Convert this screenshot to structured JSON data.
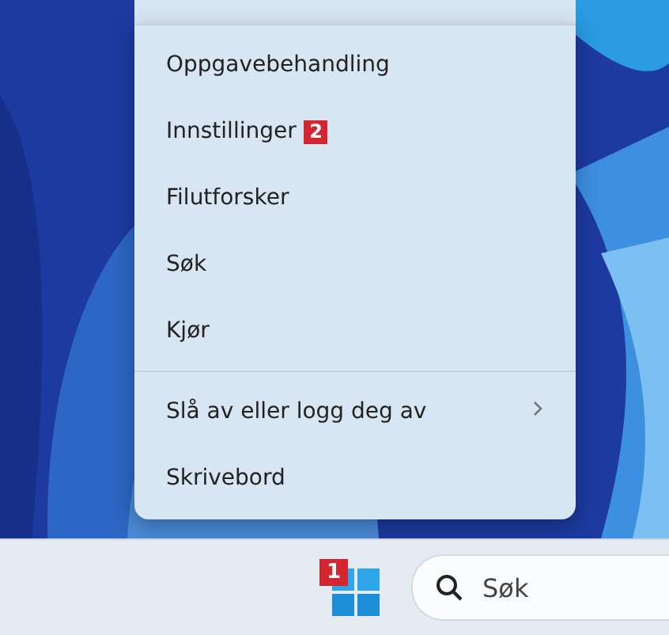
{
  "menu": {
    "sections": [
      {
        "items": [
          {
            "label": "Oppgavebehandling",
            "submenu": false
          },
          {
            "label": "Innstillinger",
            "badge": "2",
            "submenu": false
          },
          {
            "label": "Filutforsker",
            "submenu": false
          },
          {
            "label": "Søk",
            "submenu": false
          },
          {
            "label": "Kjør",
            "submenu": false
          }
        ]
      },
      {
        "items": [
          {
            "label": "Slå av eller logg deg av",
            "submenu": true
          },
          {
            "label": "Skrivebord",
            "submenu": false
          }
        ]
      }
    ]
  },
  "taskbar": {
    "start_badge": "1",
    "search": {
      "placeholder": "Søk"
    }
  }
}
